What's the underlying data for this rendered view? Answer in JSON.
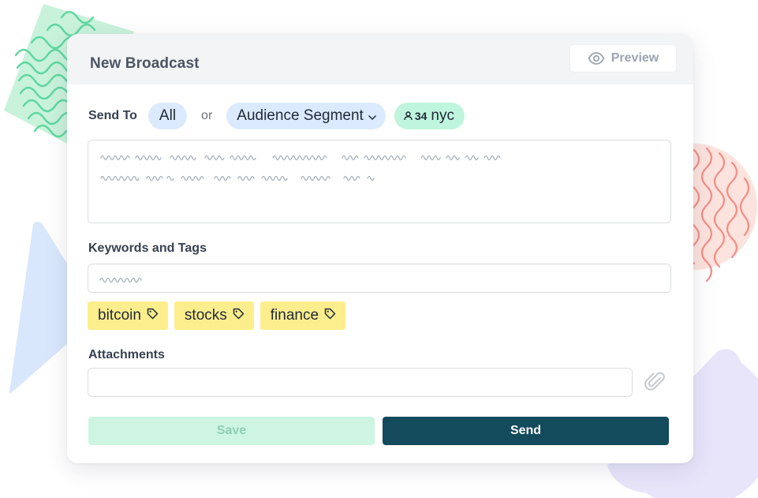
{
  "header": {
    "title": "New Broadcast",
    "preview_label": "Preview"
  },
  "send_to": {
    "label": "Send To",
    "all_label": "All",
    "or_label": "or",
    "segment_label": "Audience Segment",
    "audience_count": "34",
    "audience_name": "nyc"
  },
  "keywords": {
    "label": "Keywords and Tags",
    "tags": [
      "bitcoin",
      "stocks",
      "finance"
    ]
  },
  "attachments": {
    "label": "Attachments"
  },
  "actions": {
    "save_label": "Save",
    "send_label": "Send"
  },
  "colors": {
    "send_button": "#134a5c",
    "save_button": "#cdf5e2",
    "tag_background": "#fdee8d",
    "pill_background": "#dbeafe",
    "count_pill_background": "#bff5dd"
  },
  "icons": {
    "preview": "eye-icon",
    "segment_dropdown": "chevron-down-icon",
    "audience": "user-icon",
    "tag": "tag-icon",
    "attachment": "paperclip-icon"
  }
}
